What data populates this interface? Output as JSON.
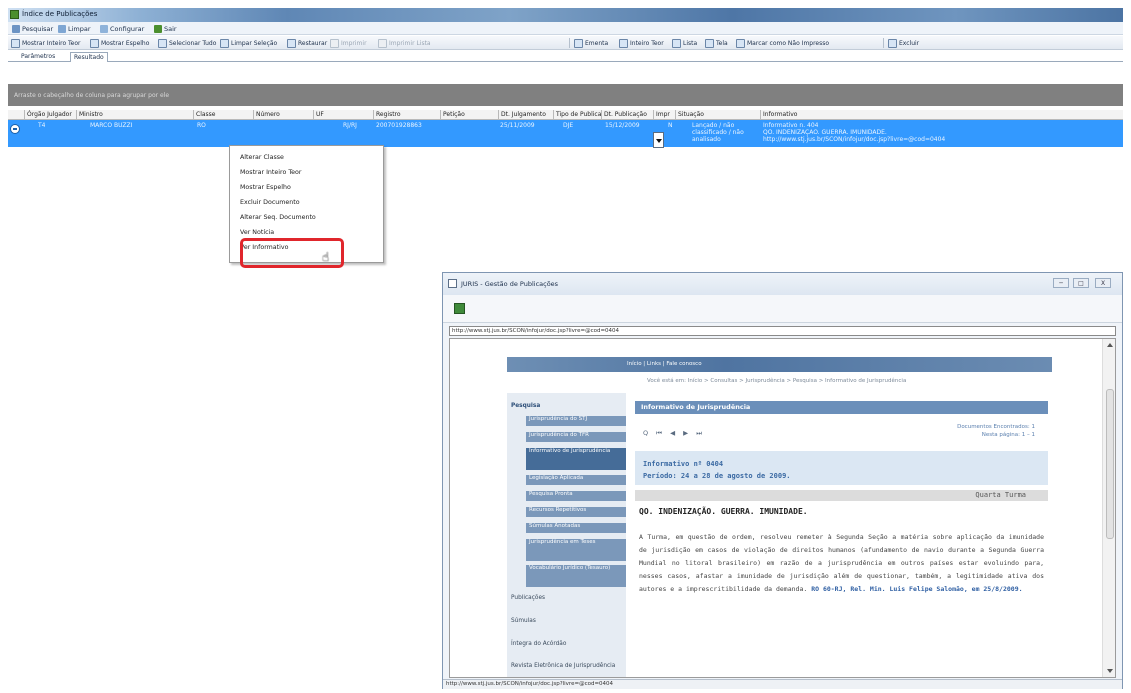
{
  "main_window": {
    "title": "Índice de Publicações"
  },
  "menubar": [
    "Pesquisar",
    "Limpar",
    "Configurar",
    "Sair"
  ],
  "toolbar": {
    "items": [
      {
        "label": "Mostrar Inteiro Teor",
        "enabled": true
      },
      {
        "label": "Mostrar Espelho",
        "enabled": true
      },
      {
        "label": "Selecionar Tudo",
        "enabled": true
      },
      {
        "label": "Limpar Seleção",
        "enabled": true
      },
      {
        "label": "Restaurar",
        "enabled": true
      },
      {
        "label": "Imprimir",
        "enabled": false
      },
      {
        "label": "Imprimir Lista",
        "enabled": false
      },
      {
        "label": "Ementa",
        "enabled": true
      },
      {
        "label": "Inteiro Teor",
        "enabled": true
      },
      {
        "label": "Lista",
        "enabled": true
      },
      {
        "label": "Tela",
        "enabled": true
      },
      {
        "label": "Marcar como Não Impresso",
        "enabled": true
      },
      {
        "label": "Excluir",
        "enabled": true
      }
    ]
  },
  "tabs": [
    {
      "label": "Parâmetros",
      "active": false
    },
    {
      "label": "Resultado",
      "active": true
    }
  ],
  "group_hint": "Arraste o cabeçalho de coluna para agrupar por ele",
  "grid": {
    "columns": [
      "Órgão Julgador",
      "Ministro",
      "Classe",
      "Número",
      "UF",
      "Registro",
      "Petição",
      "Dt. Julgamento",
      "Tipo de Publicação",
      "Dt. Publicação",
      "Impr",
      "Situação",
      "Informativo"
    ],
    "row": {
      "orgao": "T4",
      "ministro": "MARCO BUZZI",
      "classe": "RO",
      "numero": "",
      "uf": "RJ/RJ",
      "registro": "200701928863",
      "peticao": "",
      "dt_julgamento": "25/11/2009",
      "tipo": "DJE",
      "dt_publicacao": "15/12/2009",
      "impr": "N",
      "situacao_1": "Lançado / não",
      "situacao_2": "classificado / não",
      "situacao_3": "analisado",
      "info_1": "Informativo n. 404",
      "info_2": "QO. INDENIZAÇÃO. GUERRA. IMUNIDADE.",
      "info_3": "http://www.stj.jus.br/SCON/infojur/doc.jsp?livre=@cod=0404"
    }
  },
  "context_menu": {
    "items": [
      "Alterar Classe",
      "Mostrar Inteiro Teor",
      "Mostrar Espelho",
      "Excluir Documento",
      "Alterar Seq. Documento",
      "Ver Notícia",
      "Ver Informativo"
    ],
    "highlighted": "Ver Informativo"
  },
  "child_window": {
    "title": "JURIS - Gestão de Publicações",
    "address": "http://www.stj.jus.br/SCON/infojur/doc.jsp?livre=@cod=0404",
    "status": "http://www.stj.jus.br/SCON/infojur/doc.jsp?livre=@cod=0404",
    "buttons": [
      "─",
      "□",
      "X"
    ]
  },
  "webpage": {
    "topnav": "Início | Links | Fale conosco",
    "breadcrumb": "Você está em: Início > Consultas > Jurisprudência > Pesquisa > Informativo de Jurisprudência",
    "sidebar": {
      "heading": "Pesquisa",
      "subitems": [
        {
          "label": "Jurisprudência do STJ",
          "selected": false
        },
        {
          "label": "Jurisprudência do TFR",
          "selected": false
        },
        {
          "label": "Informativo de Jurisprudência",
          "selected": true
        },
        {
          "label": "Legislação Aplicada",
          "selected": false
        },
        {
          "label": "Pesquisa Pronta",
          "selected": false
        },
        {
          "label": "Recursos Repetitivos",
          "selected": false
        },
        {
          "label": "Súmulas Anotadas",
          "selected": false
        },
        {
          "label": "Jurisprudência em Teses",
          "selected": false
        },
        {
          "label": "Vocabulário Jurídico (Tesauro)",
          "selected": false
        }
      ],
      "items": [
        "Publicações",
        "Súmulas",
        "Íntegra do Acórdão",
        "Revista Eletrônica de Jurisprudência"
      ]
    },
    "content_title": "Informativo de Jurisprudência",
    "pager": "Q ⏮ ◀ ▶ ⏭",
    "docs_found": "Documentos Encontrados: 1",
    "docs_page": "Nesta página: 1 – 1",
    "info_number": "Informativo nº 0404",
    "info_period": "Período: 24 a 28 de agosto de 2009.",
    "turma": "Quarta Turma",
    "headline": "QO. INDENIZAÇÃO. GUERRA. IMUNIDADE.",
    "body": "A Turma, em questão de ordem, resolveu remeter à Segunda Seção a matéria sobre aplicação da imunidade de jurisdição em casos de violação de direitos humanos (afundamento de navio durante a Segunda Guerra Mundial no litoral brasileiro) em razão de a jurisprudência em outros países estar evoluindo para, nesses casos, afastar a imunidade de jurisdição além de questionar, também, a legitimidade ativa dos autores e a imprescritibilidade da demanda.",
    "reference": "RO 60-RJ, Rel. Min. Luis Felipe Salomão, em 25/8/2009."
  }
}
